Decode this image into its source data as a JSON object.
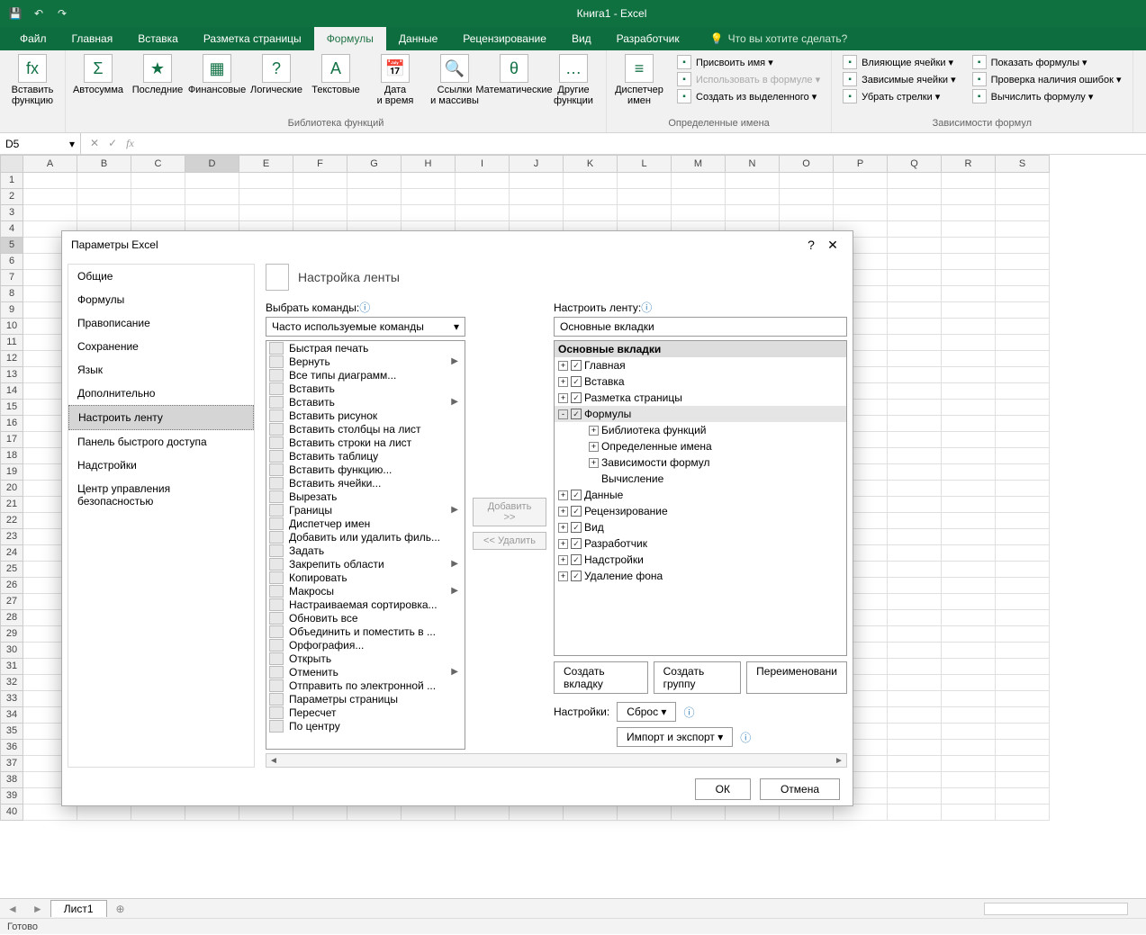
{
  "title": "Книга1 - Excel",
  "qat": {
    "save": "💾",
    "undo": "↶",
    "redo": "↷"
  },
  "tabs": [
    "Файл",
    "Главная",
    "Вставка",
    "Разметка страницы",
    "Формулы",
    "Данные",
    "Рецензирование",
    "Вид",
    "Разработчик"
  ],
  "tellme": "Что вы хотите сделать?",
  "ribbon": {
    "g1": [
      {
        "l": "Вставить функцию",
        "i": "fx"
      }
    ],
    "g2": [
      {
        "l": "Автосумма",
        "i": "Σ"
      },
      {
        "l": "Последние",
        "i": "★"
      },
      {
        "l": "Финансовые",
        "i": "▦"
      },
      {
        "l": "Логические",
        "i": "?"
      },
      {
        "l": "Текстовые",
        "i": "A"
      },
      {
        "l": "Дата и время",
        "i": "📅"
      },
      {
        "l": "Ссылки и массивы",
        "i": "🔍"
      },
      {
        "l": "Математические",
        "i": "θ"
      },
      {
        "l": "Другие функции",
        "i": "…"
      }
    ],
    "g2lbl": "Библиотека функций",
    "g3": [
      {
        "l": "Диспетчер имен",
        "i": "≡"
      }
    ],
    "g3s": [
      "Присвоить имя",
      "Использовать в формуле",
      "Создать из выделенного"
    ],
    "g3lbl": "Определенные имена",
    "g4": [
      "Влияющие ячейки",
      "Зависимые ячейки",
      "Убрать стрелки"
    ],
    "g4b": [
      "Показать формулы",
      "Проверка наличия ошибок",
      "Вычислить формулу"
    ],
    "g4lbl": "Зависимости формул"
  },
  "namebox": "D5",
  "cols": [
    "A",
    "B",
    "C",
    "D",
    "E",
    "F",
    "G",
    "H",
    "I",
    "J",
    "K",
    "L",
    "M",
    "N",
    "O",
    "P",
    "Q",
    "R",
    "S"
  ],
  "rowcount": 40,
  "activeRow": 5,
  "activeCol": "D",
  "dialog": {
    "title": "Параметры Excel",
    "cats": [
      "Общие",
      "Формулы",
      "Правописание",
      "Сохранение",
      "Язык",
      "Дополнительно",
      "Настроить ленту",
      "Панель быстрого доступа",
      "Надстройки",
      "Центр управления безопасностью"
    ],
    "activeCat": "Настроить ленту",
    "header": "Настройка ленты",
    "leftLbl": "Выбрать команды:",
    "leftCombo": "Часто используемые команды",
    "rightLbl": "Настроить ленту:",
    "rightCombo": "Основные вкладки",
    "cmds": [
      {
        "t": "Быстрая печать"
      },
      {
        "t": "Вернуть",
        "a": 1
      },
      {
        "t": "Все типы диаграмм..."
      },
      {
        "t": "Вставить"
      },
      {
        "t": "Вставить",
        "a": 1
      },
      {
        "t": "Вставить рисунок"
      },
      {
        "t": "Вставить столбцы на лист"
      },
      {
        "t": "Вставить строки на лист"
      },
      {
        "t": "Вставить таблицу"
      },
      {
        "t": "Вставить функцию..."
      },
      {
        "t": "Вставить ячейки..."
      },
      {
        "t": "Вырезать"
      },
      {
        "t": "Границы",
        "a": 1
      },
      {
        "t": "Диспетчер имен"
      },
      {
        "t": "Добавить или удалить филь..."
      },
      {
        "t": "Задать"
      },
      {
        "t": "Закрепить области",
        "a": 1
      },
      {
        "t": "Копировать"
      },
      {
        "t": "Макросы",
        "a": 1
      },
      {
        "t": "Настраиваемая сортировка..."
      },
      {
        "t": "Обновить все"
      },
      {
        "t": "Объединить и поместить в ..."
      },
      {
        "t": "Орфография..."
      },
      {
        "t": "Открыть"
      },
      {
        "t": "Отменить",
        "a": 1
      },
      {
        "t": "Отправить по электронной ..."
      },
      {
        "t": "Параметры страницы"
      },
      {
        "t": "Пересчет"
      },
      {
        "t": "По центру"
      }
    ],
    "addBtn": "Добавить >>",
    "remBtn": "<< Удалить",
    "treeHdr": "Основные вкладки",
    "tree": [
      {
        "t": "Главная",
        "e": "+",
        "c": 1
      },
      {
        "t": "Вставка",
        "e": "+",
        "c": 1
      },
      {
        "t": "Разметка страницы",
        "e": "+",
        "c": 1
      },
      {
        "t": "Формулы",
        "e": "-",
        "c": 1,
        "sel": 1
      },
      {
        "t": "Библиотека функций",
        "sub": 1,
        "e": "+"
      },
      {
        "t": "Определенные имена",
        "sub": 1,
        "e": "+"
      },
      {
        "t": "Зависимости формул",
        "sub": 1,
        "e": "+"
      },
      {
        "t": "Вычисление",
        "sub": 1,
        "e": "+",
        "noe": 1
      },
      {
        "t": "Данные",
        "e": "+",
        "c": 1
      },
      {
        "t": "Рецензирование",
        "e": "+",
        "c": 1
      },
      {
        "t": "Вид",
        "e": "+",
        "c": 1
      },
      {
        "t": "Разработчик",
        "e": "+",
        "c": 1
      },
      {
        "t": "Надстройки",
        "e": "+",
        "c": 1
      },
      {
        "t": "Удаление фона",
        "e": "+",
        "c": 1
      }
    ],
    "newTab": "Создать вкладку",
    "newGrp": "Создать группу",
    "rename": "Переименовани",
    "settings": "Настройки:",
    "reset": "Сброс",
    "impexp": "Импорт и экспорт",
    "ok": "ОК",
    "cancel": "Отмена"
  },
  "sheet": "Лист1",
  "status": "Готово"
}
